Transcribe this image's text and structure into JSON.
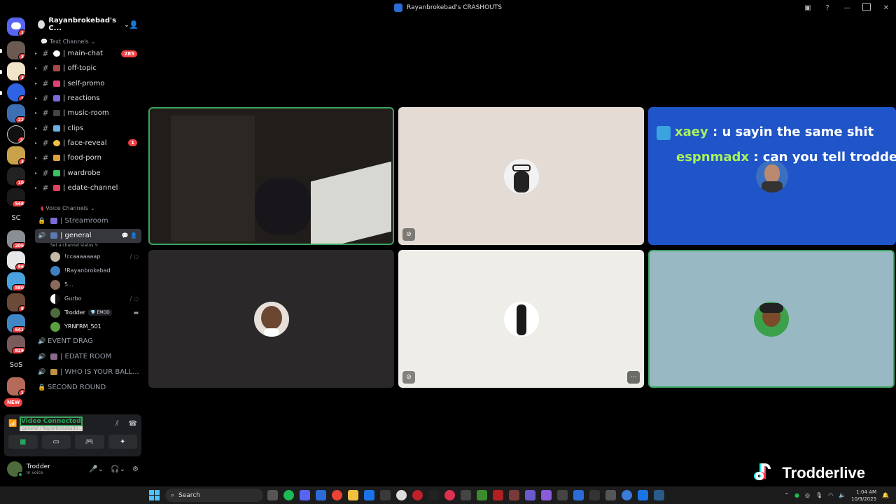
{
  "window": {
    "title": "Rayanbrokebad's CRASHOUTS"
  },
  "rail": {
    "badges": [
      "1",
      "3",
      "3",
      "1",
      "22",
      "1",
      "3",
      "10",
      "548",
      "206",
      "96",
      "880",
      "8",
      "641",
      "829",
      "1"
    ],
    "text_icons": [
      "SC",
      "SoS"
    ],
    "new_label": "NEW"
  },
  "server": {
    "name": "Rayanbrokebad's C..."
  },
  "text_category": "Text Channels",
  "text_channels": [
    {
      "name": "| main-chat",
      "badge": "285"
    },
    {
      "name": "| off-topic",
      "badge": ""
    },
    {
      "name": "| self-promo",
      "badge": ""
    },
    {
      "name": "| reactions",
      "badge": ""
    },
    {
      "name": "| music-room",
      "badge": ""
    },
    {
      "name": "| clips",
      "badge": ""
    },
    {
      "name": "| face-reveal",
      "badge": "1"
    },
    {
      "name": "| food-porn",
      "badge": ""
    },
    {
      "name": "| wardrobe",
      "badge": ""
    },
    {
      "name": "| edate-channel",
      "badge": ""
    }
  ],
  "voice_category": "Voice Channels",
  "voice_channels": {
    "streamroom": "| Streamroom",
    "general": "| general",
    "general_status": "Set a channel status",
    "users": [
      {
        "name": "!ccaaaaaaap"
      },
      {
        "name": "!Rayanbrokebad"
      },
      {
        "name": "5..."
      },
      {
        "name": "Gurbo"
      },
      {
        "name": "Trodder",
        "tag": "EMOD"
      },
      {
        "name": "YRNFRM_501"
      }
    ],
    "others": [
      "EVENT DRAG",
      "| EDATE ROOM",
      "| WHO IS YOUR BALL...",
      "SECOND ROUND"
    ]
  },
  "voice_panel": {
    "status": "Video Connected",
    "location": "| general / Rayanbrokebad's..."
  },
  "user_panel": {
    "name": "Trodder",
    "status": "In voice"
  },
  "stream_chat": [
    {
      "user": "xaey",
      "sep": ":",
      "msg": "u sayin the same shit"
    },
    {
      "user": "espnmadx",
      "sep": ":",
      "msg": "can you tell trodder o"
    }
  ],
  "watermark": "Trodderlive",
  "taskbar": {
    "search_label": "Search",
    "time": "1:04 AM",
    "date": "10/9/2025"
  },
  "colors": {
    "accent_green": "#23a55a",
    "badge_red": "#f23f43",
    "blurple": "#5865f2"
  }
}
